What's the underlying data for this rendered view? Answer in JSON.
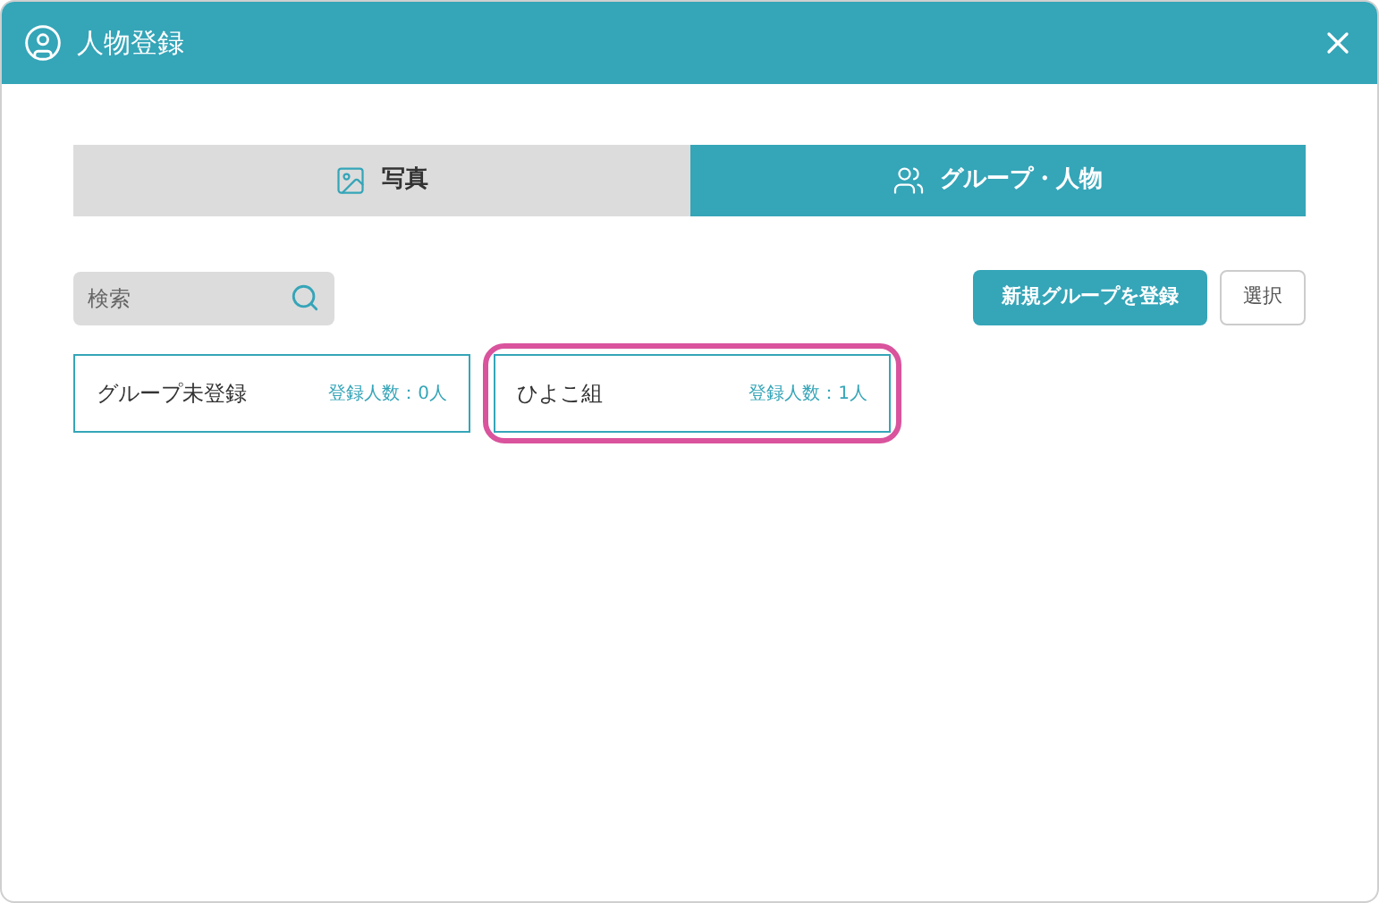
{
  "window": {
    "title": "人物登録"
  },
  "tabs": [
    {
      "label": "写真",
      "kind": "photo",
      "selected": false
    },
    {
      "label": "グループ・人物",
      "kind": "people",
      "selected": true
    }
  ],
  "search": {
    "placeholder": "検索"
  },
  "buttons": [
    {
      "label": "新規グループを登録",
      "kind": "primary"
    },
    {
      "label": "選択",
      "kind": "secondary"
    }
  ],
  "groups": [
    {
      "name": "グループ未登録",
      "count": "登録人数：0人",
      "highlighted": false
    },
    {
      "name": "ひよこ組",
      "count": "登録人数：1人",
      "highlighted": true
    }
  ]
}
